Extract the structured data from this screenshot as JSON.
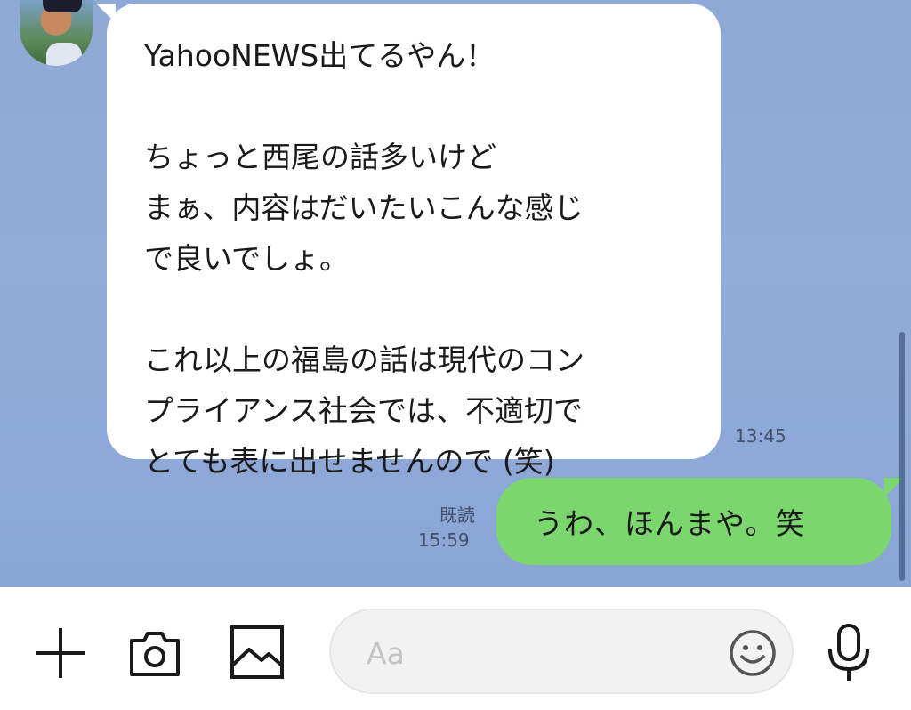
{
  "incoming": {
    "lines": [
      "YahooNEWS出てるやん！",
      "",
      "ちょっと西尾の話多いけど",
      "まぁ、内容はだいたいこんな感じ",
      "で良いでしょ。",
      "",
      "これ以上の福島の話は現代のコン",
      "プライアンス社会では、不適切で",
      "とても表に出せませんので (笑)"
    ],
    "time": "13:45"
  },
  "outgoing": {
    "text": "うわ、ほんまや。笑",
    "read_label": "既読",
    "time": "15:59"
  },
  "input_bar": {
    "placeholder": "Aa",
    "icons": [
      "plus-icon",
      "camera-icon",
      "image-icon",
      "emoji-icon",
      "microphone-icon"
    ]
  },
  "colors": {
    "chat_background": "#8fa9d6",
    "incoming_bubble": "#ffffff",
    "outgoing_bubble": "#7bd66e",
    "meta_text": "#43506a"
  }
}
